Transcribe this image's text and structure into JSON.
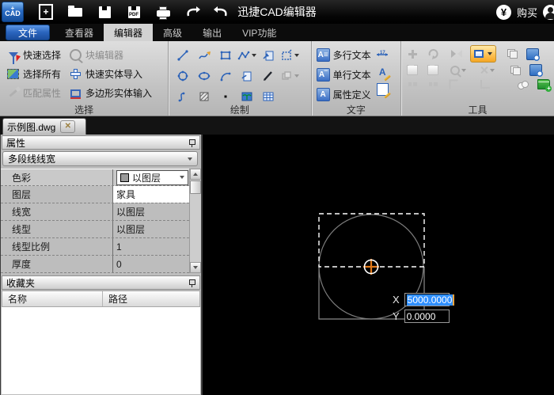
{
  "titlebar": {
    "logo_text": "CAD",
    "title": "迅捷CAD编辑器",
    "currency_symbol": "¥",
    "buy_label": "购买"
  },
  "menubar": {
    "items": [
      {
        "label": "文件",
        "active": false
      },
      {
        "label": "查看器",
        "active": false
      },
      {
        "label": "编辑器",
        "active": true
      },
      {
        "label": "高级",
        "active": false
      },
      {
        "label": "输出",
        "active": false
      },
      {
        "label": "VIP功能",
        "active": false
      }
    ]
  },
  "ribbon": {
    "select_group": {
      "label": "选择",
      "buttons": [
        {
          "label": "快速选择",
          "enabled": true
        },
        {
          "label": "块编辑器",
          "enabled": false
        },
        {
          "label": "选择所有",
          "enabled": true
        },
        {
          "label": "快速实体导入",
          "enabled": true
        },
        {
          "label": "匹配属性",
          "enabled": false
        },
        {
          "label": "多边形实体输入",
          "enabled": true
        }
      ]
    },
    "draw_group": {
      "label": "绘制",
      "icons": [
        "line",
        "sketch",
        "rectangle",
        "polyline",
        "move-block",
        "boundary",
        "circle",
        "ellipse",
        "arc",
        "ole-object",
        "pen",
        "group",
        "spline",
        "hatch",
        "point",
        "image",
        "table"
      ]
    },
    "text_group": {
      "label": "文字",
      "buttons": [
        {
          "label": "多行文本"
        },
        {
          "label": "单行文本"
        },
        {
          "label": "属性定义"
        }
      ],
      "side_icons": [
        "text-scale",
        "edit-text",
        "edit-attribute"
      ]
    },
    "tools_group": {
      "label": "工具",
      "icons": [
        "move",
        "rotate",
        "mirror",
        "display-mode",
        "copy",
        "update-block",
        "paste",
        "paste-block",
        "zoom-entity",
        "erase",
        "duplicate",
        "update-attribute",
        "distribute",
        "align",
        "fillet",
        "chamfer",
        "circles",
        "add-to-library"
      ]
    }
  },
  "document_tabs": [
    {
      "label": "示例图.dwg"
    }
  ],
  "properties_panel": {
    "title": "属性",
    "selector_value": "多段线线宽",
    "rows": [
      {
        "name": "色彩",
        "value": "以图层",
        "has_swatch": true
      },
      {
        "name": "图层",
        "value": "家具"
      },
      {
        "name": "线宽",
        "value": "以图层"
      },
      {
        "name": "线型",
        "value": "以图层"
      },
      {
        "name": "线型比例",
        "value": "1"
      },
      {
        "name": "厚度",
        "value": "0"
      }
    ]
  },
  "favorites_panel": {
    "title": "收藏夹",
    "columns": [
      {
        "label": "名称"
      },
      {
        "label": "路径"
      }
    ]
  },
  "canvas": {
    "objects": [
      "circle",
      "rectangle",
      "selection-rectangle",
      "crosshair-marker"
    ],
    "coords": {
      "x_label": "X",
      "x_value": "5000.0000",
      "y_label": "Y",
      "y_value": "0.0000"
    }
  },
  "colors": {
    "selection_blue": "#2f8fff",
    "crosshair_orange": "#e07818",
    "highlight_orange": "#f5a623",
    "accent_blue": "#2b62b8",
    "canvas_bg": "#000000"
  }
}
